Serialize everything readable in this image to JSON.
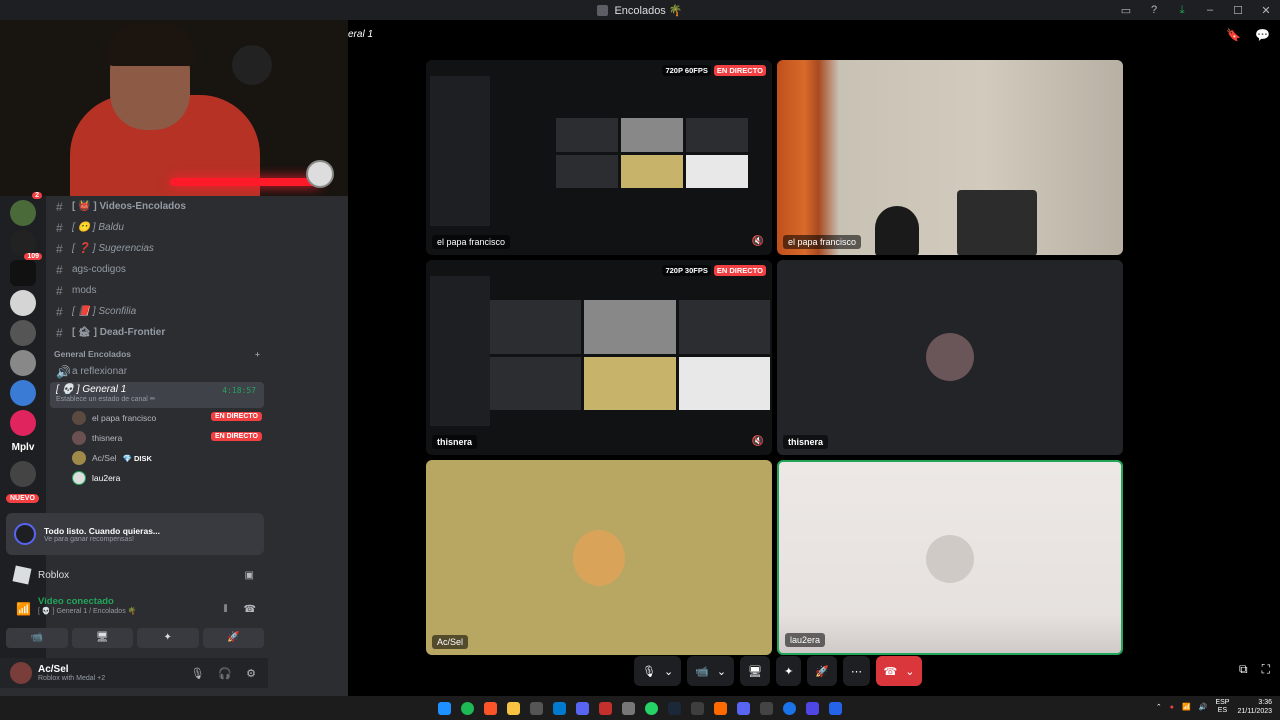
{
  "window": {
    "title": "Encolados 🌴",
    "controls": [
      "▭",
      "?",
      "⤓",
      "–",
      "☐",
      "✕"
    ]
  },
  "channel_title": "eral 1",
  "server_rail": {
    "badges": [
      "2",
      "109"
    ],
    "mplv": "Mplv",
    "nuevo": "NUEVO"
  },
  "channels": [
    {
      "name": "[ 👹 ] Videos-Encolados",
      "style": "bold"
    },
    {
      "name": "[ 😶 ] Baldu",
      "style": "italic"
    },
    {
      "name": "[ ❓ ] Sugerencias",
      "style": "italic"
    },
    {
      "name": "ags-codigos",
      "style": "plain"
    },
    {
      "name": "mods",
      "style": "plain"
    },
    {
      "name": "[ 📕 ] Sconfilia",
      "style": "italic"
    },
    {
      "name": "[ 🏚 ] Dead-Frontier",
      "style": "bold"
    }
  ],
  "category": {
    "label": "General Encolados",
    "add": "+"
  },
  "voice_channels": {
    "reflexionar": "a reflexionar",
    "active": {
      "name": "[ 💀 ] General 1",
      "time": "4:18:57",
      "status": "Establece un estado de canal ✏"
    }
  },
  "members": [
    {
      "name": "el papa francisco",
      "live": "EN DIRECTO"
    },
    {
      "name": "thisnera",
      "live": "EN DIRECTO"
    },
    {
      "name": "Ac/Sel",
      "extra": "💎 DISK"
    },
    {
      "name": "lau2era"
    }
  ],
  "promo": {
    "title": "Todo listo. Cuando quieras...",
    "subtitle": "Ve para ganar recompensas!"
  },
  "activity": {
    "label": "Roblox"
  },
  "voice_panel": {
    "status": "Video conectado",
    "location": "[ 💀 ] General 1 / Encolados 🌴",
    "buttons": [
      "📹",
      "🖥",
      "✦",
      "🚀"
    ]
  },
  "user": {
    "name": "Ac/Sel",
    "status": "Roblox with Medal +2"
  },
  "tiles": [
    {
      "label": "el papa francisco",
      "quality": "720P 60FPS",
      "live": "EN DIRECTO"
    },
    {
      "label": "el papa francisco"
    },
    {
      "label": "thisnera",
      "quality": "720P 30FPS",
      "live": "EN DIRECTO"
    },
    {
      "label": "thisnera"
    },
    {
      "label": "Ac/Sel"
    },
    {
      "label": "lau2era"
    }
  ],
  "callbar": {
    "hangup": "☎"
  },
  "taskbar": {
    "lang_top": "ESP",
    "lang_bottom": "ES",
    "time": "3:36",
    "date": "21/11/2023"
  },
  "colors": {
    "accent_green": "#23a55a",
    "live_red": "#f23f42",
    "bg": "#2b2d31",
    "hangup": "#da373c"
  }
}
